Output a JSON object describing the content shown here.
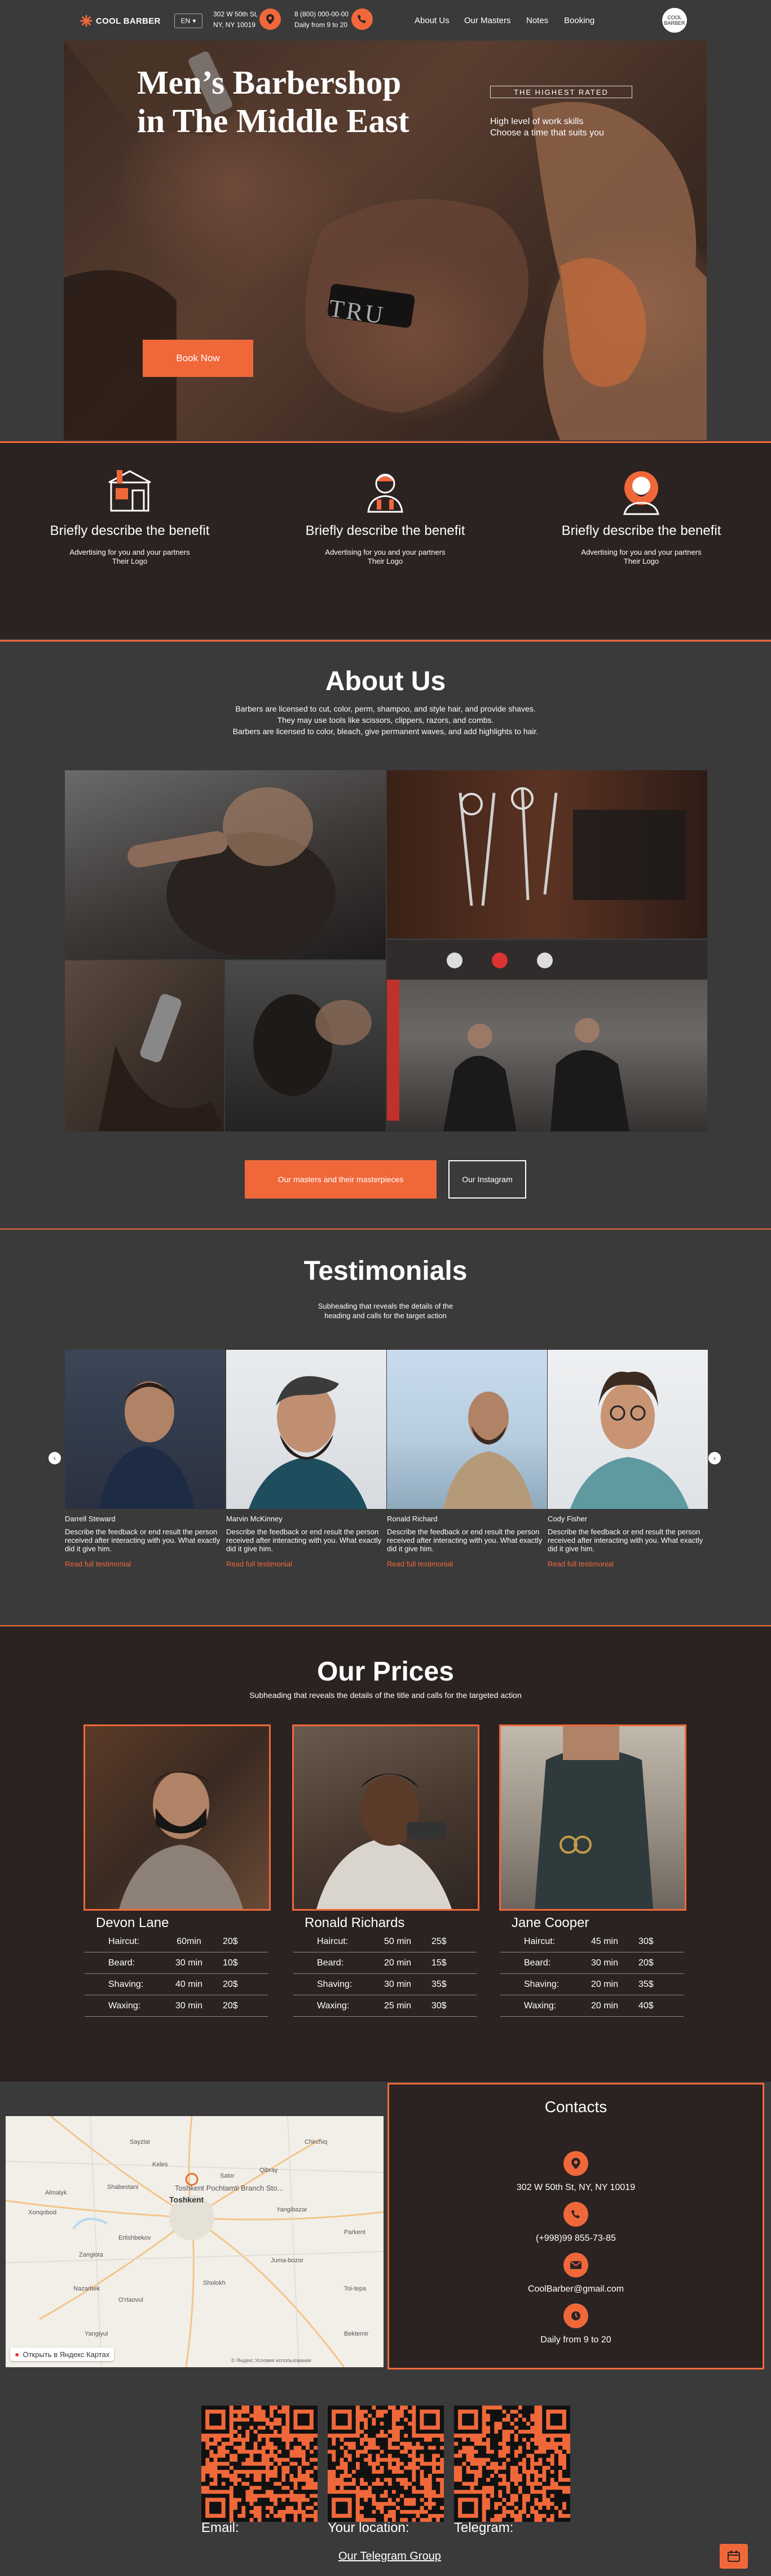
{
  "header": {
    "logo_text": "COOL BARBER",
    "lang": "EN",
    "address_line1": "302 W 50th St,",
    "address_line2": "NY, NY 10019",
    "phone": "8 (800) 000-00-00",
    "hours": "Daily from 9 to 20",
    "nav": [
      "About Us",
      "Our Masters",
      "Notes",
      "Booking"
    ],
    "badge_text": "COOL BARBER"
  },
  "hero": {
    "title_line1": "Men’s Barbershop",
    "title_line2": "in The Middle East",
    "badge": "THE HIGHEST RATED",
    "sub_line1": "High level of work skills",
    "sub_line2": "Choose a time that suits you",
    "razor_text": "TRU",
    "cta": "Book Now"
  },
  "benefits": [
    {
      "icon": "barbershop-icon",
      "title": "Briefly describe the benefit",
      "line1": "Advertising for you and your partners",
      "line2": "Their Logo"
    },
    {
      "icon": "barber-icon",
      "title": "Briefly describe the benefit",
      "line1": "Advertising for you and your partners",
      "line2": "Their Logo"
    },
    {
      "icon": "bearded-man-icon",
      "title": "Briefly describe the benefit",
      "line1": "Advertising for you and your partners",
      "line2": "Their Logo"
    }
  ],
  "about": {
    "title": "About Us",
    "line1": "Barbers are licensed to cut, color, perm, shampoo, and style hair, and provide shaves.",
    "line2": "They may use tools like scissors, clippers, razors, and combs.",
    "line3": "Barbers are licensed to color, bleach, give permanent waves, and add highlights to hair.",
    "btn_masters": "Our masters and their masterpieces",
    "btn_instagram": "Our Instagram"
  },
  "testimonials": {
    "title": "Testimonials",
    "sub_line1": "Subheading that reveals the details of the",
    "sub_line2": "heading and calls for the target action",
    "cards": [
      {
        "name": "Darrell Steward",
        "text": "Describe the feedback or end result the person received after interacting with you. What exactly did it give him.",
        "link": "Read full testimonial"
      },
      {
        "name": "Marvin McKinney",
        "text": "Describe the feedback or end result the person received after interacting with you. What exactly did it give him.",
        "link": "Read full testimonial"
      },
      {
        "name": "Ronald Richard",
        "text": "Describe the feedback or end result the person received after interacting with you. What exactly did it give him.",
        "link": "Read full testimonial"
      },
      {
        "name": "Cody Fisher",
        "text": "Describe the feedback or end result the person received after interacting with you. What exactly did it give him.",
        "link": "Read full testimonial"
      }
    ]
  },
  "prices": {
    "title": "Our Prices",
    "sub": "Subheading that reveals the details of the title and calls for the targeted action",
    "masters": [
      {
        "name": "Devon Lane",
        "rows": [
          [
            "Haircut:",
            "60min",
            "20$"
          ],
          [
            "Beard:",
            "30 min",
            "10$"
          ],
          [
            "Shaving:",
            "40 min",
            "20$"
          ],
          [
            "Waxing:",
            "30 min",
            "20$"
          ]
        ]
      },
      {
        "name": "Ronald Richards",
        "rows": [
          [
            "Haircut:",
            "50 min",
            "25$"
          ],
          [
            "Beard:",
            "20 min",
            "15$"
          ],
          [
            "Shaving:",
            "30 min",
            "35$"
          ],
          [
            "Waxing:",
            "25 min",
            "30$"
          ]
        ]
      },
      {
        "name": "Jane Cooper",
        "rows": [
          [
            "Haircut:",
            "45 min",
            "30$"
          ],
          [
            "Beard:",
            "30 min",
            "20$"
          ],
          [
            "Shaving:",
            "20 min",
            "35$"
          ],
          [
            "Waxing:",
            "20 min",
            "40$"
          ]
        ]
      }
    ]
  },
  "map": {
    "city": "Toshkent",
    "poi": "Toshkent Pochtamti Branch Sto...",
    "labels": [
      "Chirchiq",
      "Qibray",
      "Salor",
      "Keles",
      "Sayzlar",
      "Shabestani",
      "Almalyk",
      "Xonqobod",
      "Ertishbekov",
      "Yangibazar",
      "Parkent",
      "Juma-bozor",
      "Zangiota",
      "Nazarbek",
      "O'rtaovul",
      "Yangiyul",
      "Sholokh",
      "Toi-tepa",
      "Bektemir"
    ],
    "open_link": "Открыть в Яндекс Картах",
    "copyright": "© Яндекс  Условия использования"
  },
  "contacts": {
    "title": "Contacts",
    "address": "302 W 50th St, NY, NY 10019",
    "phone": "(+998)99 855-73-85",
    "email": "CoolBarber@gmail.com",
    "hours": "Daily from 9 to 20"
  },
  "qr": {
    "labels": [
      "Email:",
      "Your location:",
      "Telegram:"
    ],
    "telegram_link": "Our Telegram Group"
  },
  "colors": {
    "accent": "#f0683a",
    "dark": "#2b2322",
    "bg": "#3a3a3b"
  }
}
